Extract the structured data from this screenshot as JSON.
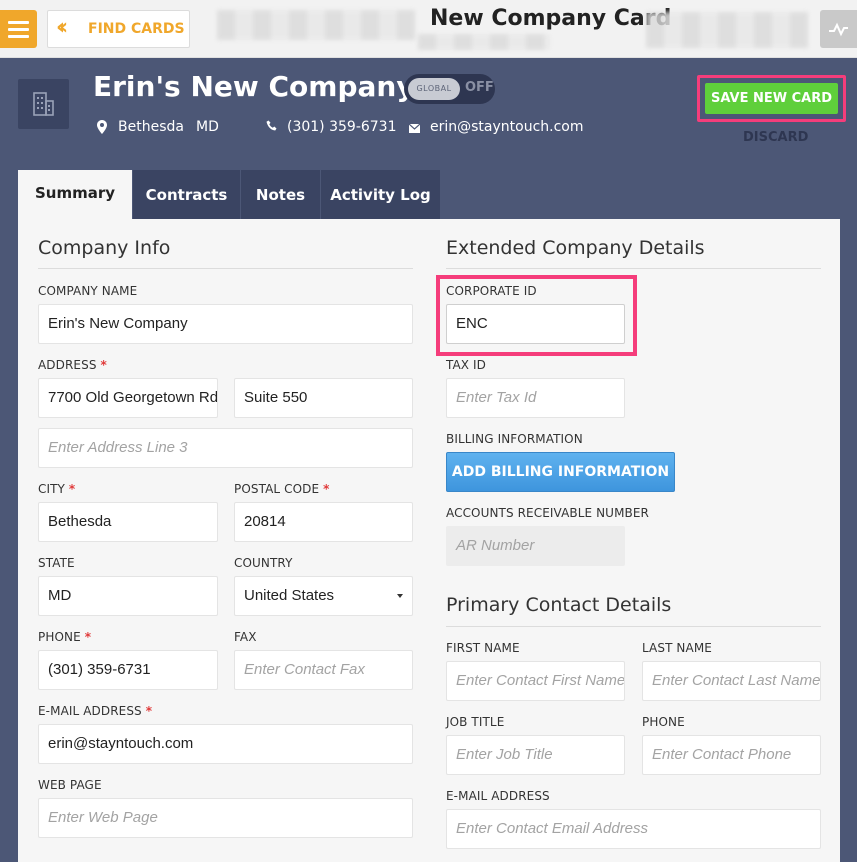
{
  "topbar": {
    "find_cards_label": "FIND CARDS",
    "page_title": "New Company Card"
  },
  "header": {
    "company_name": "Erin's New Company",
    "global_toggle": {
      "label": "GLOBAL",
      "state": "OFF"
    },
    "city": "Bethesda",
    "state": "MD",
    "phone": "(301) 359-6731",
    "email": "erin@stayntouch.com",
    "save_label": "SAVE NEW CARD",
    "discard_label": "DISCARD"
  },
  "tabs": [
    {
      "label": "Summary",
      "active": true
    },
    {
      "label": "Contracts"
    },
    {
      "label": "Notes"
    },
    {
      "label": "Activity Log"
    }
  ],
  "company_info": {
    "title": "Company Info",
    "company_name_label": "COMPANY NAME",
    "company_name_value": "Erin's New Company",
    "address_label": "ADDRESS",
    "address_line1": "7700 Old Georgetown Rd",
    "address_line2": "Suite 550",
    "address_line3_placeholder": "Enter Address Line 3",
    "city_label": "CITY",
    "city_value": "Bethesda",
    "postal_code_label": "POSTAL CODE",
    "postal_code_value": "20814",
    "state_label": "STATE",
    "state_value": "MD",
    "country_label": "COUNTRY",
    "country_value": "United States",
    "phone_label": "PHONE",
    "phone_value": "(301) 359-6731",
    "fax_label": "FAX",
    "fax_placeholder": "Enter Contact Fax",
    "email_label": "E-MAIL ADDRESS",
    "email_value": "erin@stayntouch.com",
    "web_label": "WEB PAGE",
    "web_placeholder": "Enter Web Page",
    "required_mark": "*"
  },
  "extended": {
    "title": "Extended Company Details",
    "corporate_id_label": "CORPORATE ID",
    "corporate_id_value": "ENC",
    "tax_id_label": "TAX ID",
    "tax_id_placeholder": "Enter Tax Id",
    "billing_label": "BILLING INFORMATION",
    "billing_button": "ADD BILLING INFORMATION",
    "ar_label": "ACCOUNTS RECEIVABLE NUMBER",
    "ar_placeholder": "AR Number"
  },
  "primary_contact": {
    "title": "Primary Contact Details",
    "first_name_label": "FIRST NAME",
    "first_name_placeholder": "Enter Contact First Name",
    "last_name_label": "LAST NAME",
    "last_name_placeholder": "Enter Contact Last Name",
    "job_title_label": "JOB TITLE",
    "job_title_placeholder": "Enter Job Title",
    "phone_label": "PHONE",
    "phone_placeholder": "Enter Contact Phone",
    "email_label": "E-MAIL ADDRESS",
    "email_placeholder": "Enter Contact Email Address"
  },
  "colors": {
    "brand_orange": "#f0a72b",
    "header_bg": "#4c5776",
    "save_green": "#5fcf3b",
    "highlight_pink": "#f53d7b",
    "billing_blue": "#4aa3e6"
  }
}
